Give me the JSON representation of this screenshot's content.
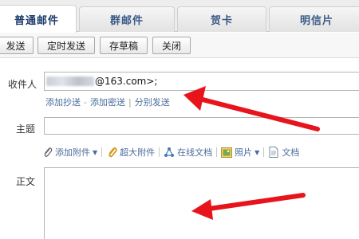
{
  "tabs": [
    {
      "label": "普通邮件",
      "active": true
    },
    {
      "label": "群邮件",
      "active": false
    },
    {
      "label": "贺卡",
      "active": false
    },
    {
      "label": "明信片",
      "active": false
    }
  ],
  "toolbar": {
    "send": "发送",
    "schedule": "定时发送",
    "draft": "存草稿",
    "close": "关闭"
  },
  "compose": {
    "to_label": "收件人",
    "to_value": "@163.com>;",
    "links": {
      "cc": "添加抄送",
      "bcc": "添加密送",
      "separate": "分别发送"
    },
    "subject_label": "主题",
    "subject_value": "",
    "body_label": "正文"
  },
  "attachments": {
    "add": "添加附件",
    "large": "超大附件",
    "online_doc": "在线文档",
    "photo": "照片",
    "doc": "文档"
  },
  "colors": {
    "annotation_red": "#e8141c",
    "link_blue": "#4a6c9b"
  }
}
